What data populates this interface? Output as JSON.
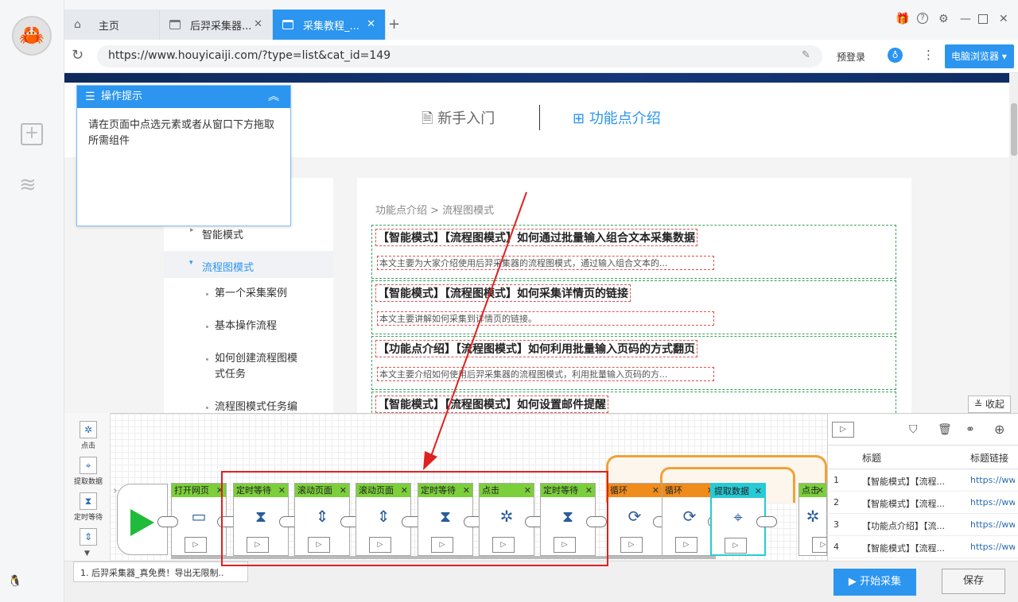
{
  "tabs": [
    {
      "label": "主页"
    },
    {
      "label": "后羿采集器..."
    },
    {
      "label": "采集教程_..."
    }
  ],
  "address": {
    "url": "https://www.houyicaiji.com/?type=list&cat_id=149"
  },
  "toolbar": {
    "prelogin": "预登录",
    "browser": "电脑浏览器"
  },
  "page": {
    "nav_newbie": "新手入门",
    "nav_features": "功能点介绍",
    "breadcrumb": "功能点介绍 > 流程图模式",
    "menu": {
      "smart": "智能模式",
      "flow": "流程图模式",
      "sub": [
        "第一个采集案例",
        "基本操作流程",
        "如何创建流程图模\n式任务",
        "流程图模式任务编"
      ]
    },
    "articles": [
      {
        "title": "【智能模式】【流程图模式】如何通过批量输入组合文本采集数据",
        "summary": "本文主要为大家介绍使用后羿采集器的流程图模式，通过输入组合文本的..."
      },
      {
        "title": "【智能模式】【流程图模式】如何采集详情页的链接",
        "summary": "本文主要讲解如何采集到详情页的链接。"
      },
      {
        "title": "【功能点介绍】【流程图模式】如何利用批量输入页码的方式翻页",
        "summary": "本文主要介绍如何使用后羿采集器的流程图模式，利用批量输入页码的方..."
      },
      {
        "title": "【智能模式】【流程图模式】如何设置邮件提醒",
        "summary": ""
      }
    ],
    "collapse": "收起"
  },
  "tip": {
    "title": "操作提示",
    "body": "请在页面中点选元素或者从窗口下方拖取所需组件"
  },
  "tools": [
    "点击",
    "提取数据",
    "定时等待"
  ],
  "flow": {
    "nodes": [
      {
        "label": "打开网页",
        "icon": "webpage-icon",
        "color": "g"
      },
      {
        "label": "定时等待",
        "icon": "hourglass-icon",
        "color": "g"
      },
      {
        "label": "滚动页面",
        "icon": "scroll-icon",
        "color": "g"
      },
      {
        "label": "滚动页面",
        "icon": "scroll-icon",
        "color": "g"
      },
      {
        "label": "定时等待",
        "icon": "hourglass-icon",
        "color": "g"
      },
      {
        "label": "点击",
        "icon": "click-icon",
        "color": "g"
      },
      {
        "label": "定时等待",
        "icon": "hourglass-icon",
        "color": "g"
      },
      {
        "label": "循环",
        "icon": "loop-icon",
        "color": "o"
      },
      {
        "label": "循环",
        "icon": "loop-icon",
        "color": "o"
      },
      {
        "label": "提取数据",
        "icon": "extract-icon",
        "color": "c"
      },
      {
        "label": "点击",
        "icon": "click-icon",
        "color": "g"
      }
    ]
  },
  "results": {
    "headers": [
      "标题",
      "标题链接"
    ],
    "rows": [
      {
        "n": "1",
        "title": "【智能模式】【流程...",
        "link": "https://ww"
      },
      {
        "n": "2",
        "title": "【智能模式】【流程...",
        "link": "https://ww"
      },
      {
        "n": "3",
        "title": "【功能点介绍】【流...",
        "link": "https://ww"
      },
      {
        "n": "4",
        "title": "【智能模式】【流程...",
        "link": "https://ww"
      }
    ]
  },
  "status": "1. 后羿采集器_真免费！导出无限制..",
  "buttons": {
    "start": "开始采集",
    "save": "保存"
  },
  "colors": {
    "accent": "#2b95f0",
    "node_green": "#7bcf3b",
    "node_orange": "#f08c1c",
    "node_cyan": "#27cbd6",
    "highlight_red": "#e02020"
  }
}
